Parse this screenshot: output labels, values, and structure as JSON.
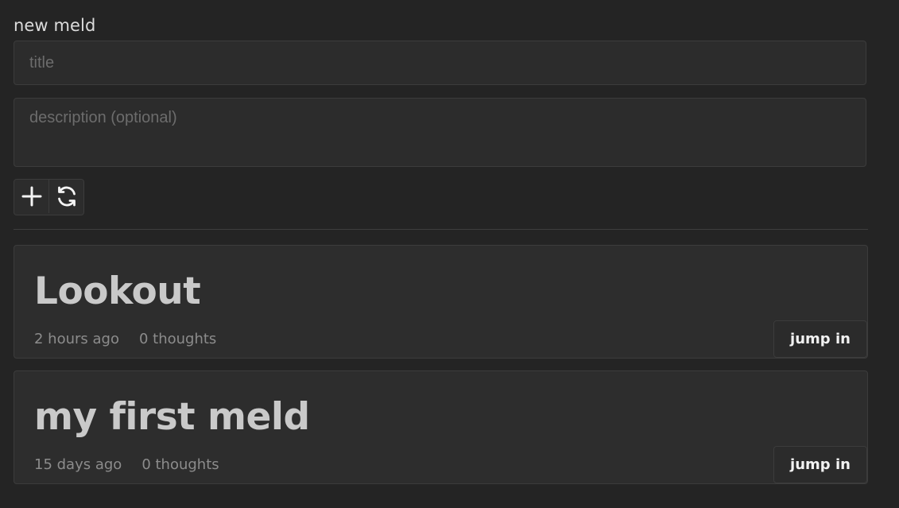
{
  "form": {
    "heading": "new meld",
    "title_placeholder": "title",
    "title_value": "",
    "description_placeholder": "description (optional)",
    "description_value": "",
    "add_icon": "plus-icon",
    "refresh_icon": "refresh-icon"
  },
  "melds": [
    {
      "title": "Lookout",
      "age": "2 hours ago",
      "thoughts": "0 thoughts",
      "action_label": "jump in"
    },
    {
      "title": "my first meld",
      "age": "15 days ago",
      "thoughts": "0 thoughts",
      "action_label": "jump in"
    }
  ],
  "colors": {
    "background": "#242424",
    "surface": "#2d2d2d",
    "border": "#3c3c3c",
    "text": "#c9c9c9",
    "muted_text": "#8c8c8c"
  }
}
